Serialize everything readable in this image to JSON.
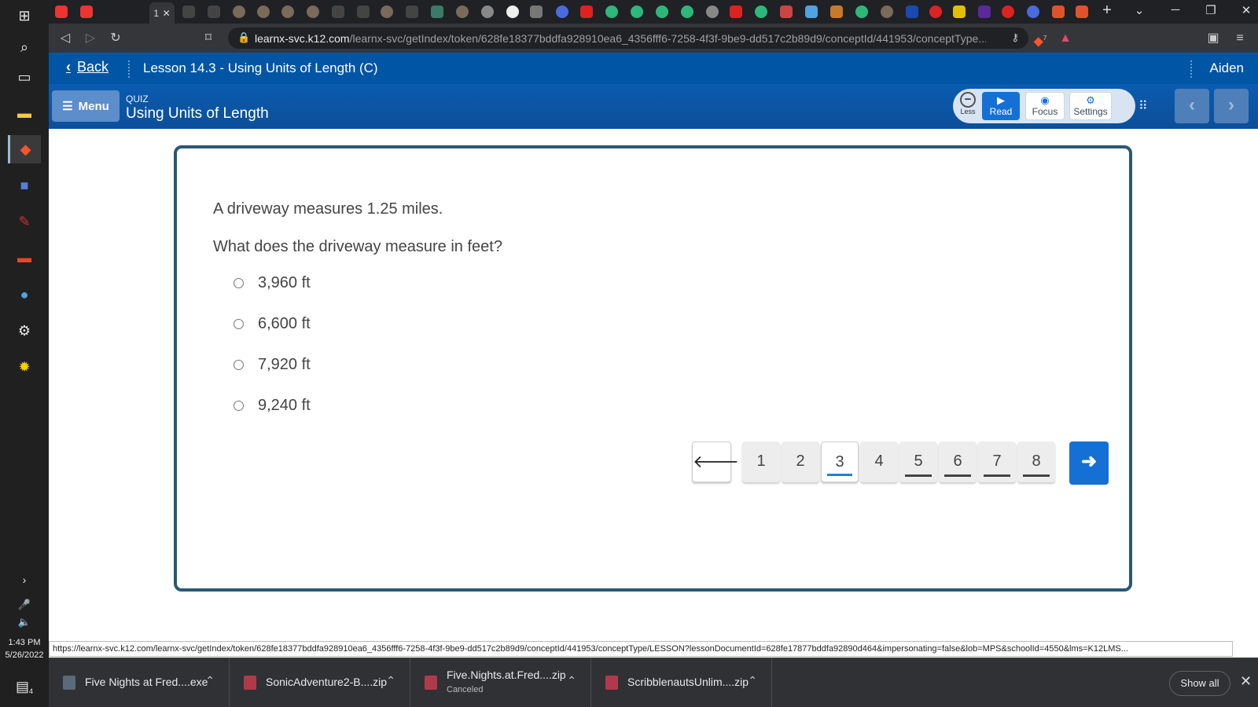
{
  "browser": {
    "url_host": "learnx-svc.k12.com",
    "url_path": "/learnx-svc/getIndex/token/628fe18377bddfa928910ea6_4356fff6-7258-4f3f-9be9-dd517c2b89d9/conceptId/441953/conceptType...",
    "active_tab_label": "1",
    "status_url": "https://learnx-svc.k12.com/learnx-svc/getIndex/token/628fe18377bddfa928910ea6_4356fff6-7258-4f3f-9be9-dd517c2b89d9/conceptId/441953/conceptType/LESSON?lessonDocumentId=628fe17877bddfa92890d464&impersonating=false&lob=MPS&schoolId=4550&lms=K12LMS...",
    "brave_badge": "7"
  },
  "header": {
    "back_label": "Back",
    "lesson_title": "Lesson 14.3 - Using Units of Length (C)",
    "user_name": "Aiden"
  },
  "subheader": {
    "menu_label": "Menu",
    "quiz_label": "QUIZ",
    "quiz_title": "Using Units of Length",
    "tools": {
      "less": "Less",
      "read": "Read",
      "focus": "Focus",
      "settings": "Settings"
    }
  },
  "question": {
    "statement": "A driveway measures 1.25 miles.",
    "prompt": "What does the driveway measure in feet?",
    "choices": [
      "3,960 ft",
      "6,600 ft",
      "7,920 ft",
      "9,240 ft"
    ]
  },
  "pager": {
    "pages": [
      "1",
      "2",
      "3",
      "4",
      "5",
      "6",
      "7",
      "8"
    ],
    "current_page": "3"
  },
  "downloads": {
    "items": [
      {
        "name": "Five Nights at Fred....exe",
        "sub": ""
      },
      {
        "name": "SonicAdventure2-B....zip",
        "sub": ""
      },
      {
        "name": "Five.Nights.at.Fred....zip",
        "sub": "Canceled"
      },
      {
        "name": "ScribblenautsUnlim....zip",
        "sub": ""
      }
    ],
    "show_all": "Show all"
  },
  "taskbar": {
    "time": "1:43 PM",
    "date": "5/26/2022",
    "notification_count": "4"
  },
  "colors": {
    "header_blue": "#0055a5",
    "accent_blue": "#1570d6",
    "card_border": "#2b5873"
  }
}
